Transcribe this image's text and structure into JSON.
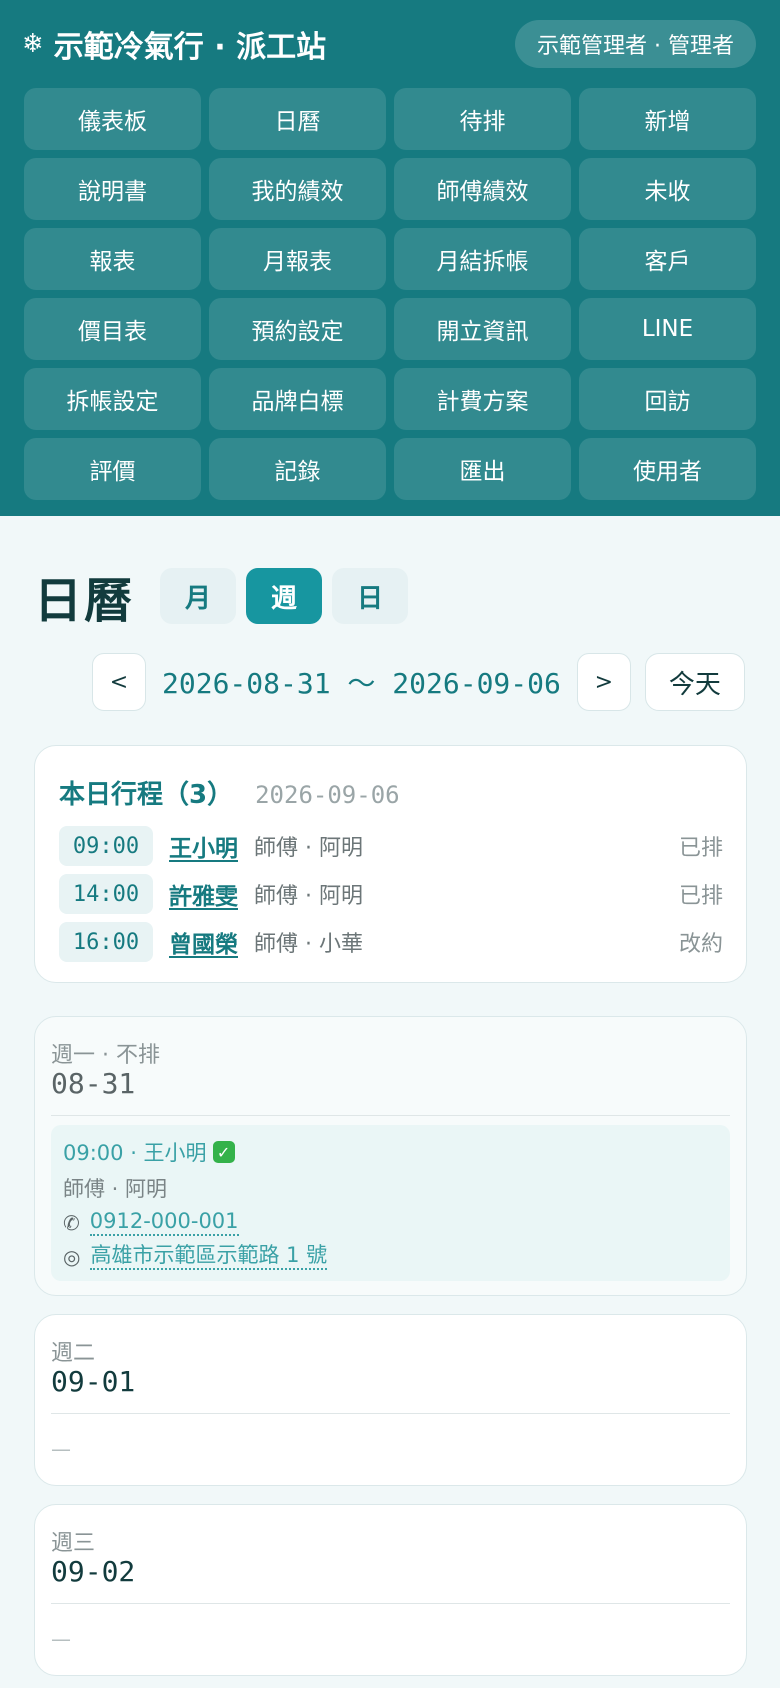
{
  "header": {
    "brand_icon": "snowflake-icon",
    "brand": "示範冷氣行 · 派工站",
    "user": "示範管理者 · 管理者",
    "nav": [
      "儀表板",
      "日曆",
      "待排",
      "新增",
      "說明書",
      "我的績效",
      "師傅績效",
      "未收",
      "報表",
      "月報表",
      "月結拆帳",
      "客戶",
      "價目表",
      "預約設定",
      "開立資訊",
      "LINE",
      "拆帳設定",
      "品牌白標",
      "計費方案",
      "回訪",
      "評價",
      "記錄",
      "匯出",
      "使用者"
    ]
  },
  "calendar": {
    "title": "日曆",
    "views": [
      "月",
      "週",
      "日"
    ],
    "active_view": "週",
    "prev": "<",
    "next": ">",
    "range": "2026-08-31 ～ 2026-09-06",
    "today_button": "今天"
  },
  "today": {
    "title": "本日行程（3）",
    "date": "2026-09-06",
    "items": [
      {
        "time": "09:00",
        "customer": "王小明",
        "tech": "師傅 · 阿明",
        "status": "已排"
      },
      {
        "time": "14:00",
        "customer": "許雅雯",
        "tech": "師傅 · 阿明",
        "status": "已排"
      },
      {
        "time": "16:00",
        "customer": "曾國榮",
        "tech": "師傅 · 小華",
        "status": "改約"
      }
    ]
  },
  "days": [
    {
      "label": "週一 · 不排",
      "date": "08-31",
      "appointment": {
        "head": "09:00 · 王小明",
        "tech": "師傅 · 阿明",
        "phone": "0912-000-001",
        "address": "高雄市示範區示範路 1 號"
      }
    },
    {
      "label": "週二",
      "date": "09-01",
      "empty": "—"
    },
    {
      "label": "週三",
      "date": "09-02",
      "empty": "—"
    }
  ],
  "colors": {
    "header_bg": "#167a80",
    "accent": "#1796a0",
    "link": "#3aa1a6",
    "page_bg": "#f1f8f9"
  }
}
